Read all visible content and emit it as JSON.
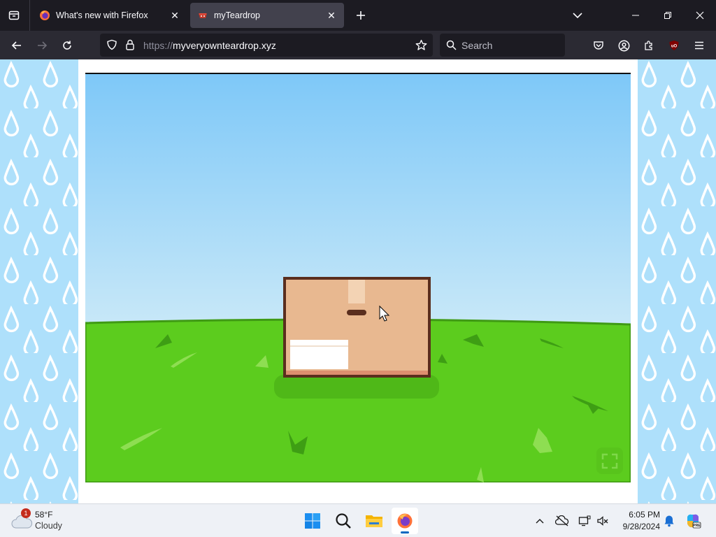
{
  "browser": {
    "tabs": [
      {
        "title": "What's new with Firefox",
        "active": false,
        "favicon": "firefox-icon"
      },
      {
        "title": "myTeardrop",
        "active": true,
        "favicon": "teardrop-favicon"
      }
    ],
    "url_scheme": "https://",
    "url_host": "myveryownteardrop.xyz",
    "search_placeholder": "Search"
  },
  "colors": {
    "sky_top": "#7ec8f8",
    "sky_bottom": "#c8e8f8",
    "grass": "#5ccc1e",
    "box": "#e8b890",
    "box_border": "#5a2e1e",
    "pattern_bg": "#aee0fb"
  },
  "taskbar": {
    "weather_temp": "58°F",
    "weather_condition": "Cloudy",
    "weather_badge": "1",
    "time": "6:05 PM",
    "date": "9/28/2024",
    "apps": [
      "start-icon",
      "search-icon",
      "file-explorer-icon",
      "firefox-icon"
    ]
  }
}
